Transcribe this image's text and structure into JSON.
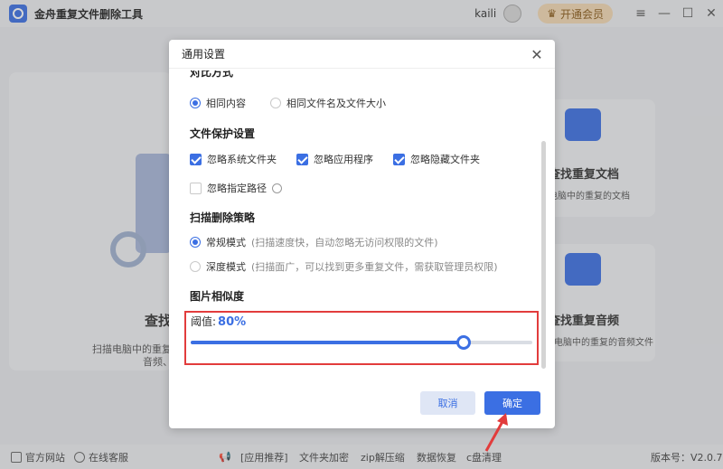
{
  "app": {
    "title": "金舟重复文件删除工具",
    "username": "kaili",
    "vip_label": "开通会员"
  },
  "window_controls": {
    "menu": "≡",
    "minimize": "—",
    "maximize": "☐",
    "close": "✕"
  },
  "background": {
    "left_card": {
      "title": "查找",
      "desc": "扫描电脑中的重复",
      "desc2": "音频、"
    },
    "right_card1": {
      "title": "查找重复文档",
      "desc": "电脑中的重复的文档"
    },
    "right_card2": {
      "title": "查找重复音频",
      "desc": "描电脑中的重复的音频文件"
    }
  },
  "statusbar": {
    "official_site": "官方网站",
    "online_service": "在线客服",
    "app_recommend": "[应用推荐]",
    "folder_encrypt": "文件夹加密",
    "zip_tool": "zip解压缩",
    "data_recovery": "数据恢复",
    "c_clean": "c盘清理",
    "version": "版本号：V2.0.7"
  },
  "dialog": {
    "title": "通用设置",
    "compare_section": "对比方式",
    "compare_options": [
      {
        "label": "相同内容",
        "selected": true
      },
      {
        "label": "相同文件名及文件大小",
        "selected": false
      }
    ],
    "protect_section": "文件保护设置",
    "protect_options": [
      {
        "label": "忽略系统文件夹",
        "checked": true
      },
      {
        "label": "忽略应用程序",
        "checked": true
      },
      {
        "label": "忽略隐藏文件夹",
        "checked": true
      },
      {
        "label": "忽略指定路径",
        "checked": false
      }
    ],
    "scan_section": "扫描删除策略",
    "scan_options": [
      {
        "label": "常规模式",
        "hint": "(扫描速度快，自动忽略无访问权限的文件)",
        "selected": true
      },
      {
        "label": "深度模式",
        "hint": "(扫描面广，可以找到更多重复文件，需获取管理员权限)",
        "selected": false
      }
    ],
    "similarity_section": "图片相似度",
    "threshold_label": "阈值:",
    "threshold_value": "80%",
    "threshold_fraction": 0.8,
    "cancel_label": "取消",
    "ok_label": "确定"
  },
  "colors": {
    "accent": "#3b6fe3",
    "highlight": "#e23c3c"
  }
}
